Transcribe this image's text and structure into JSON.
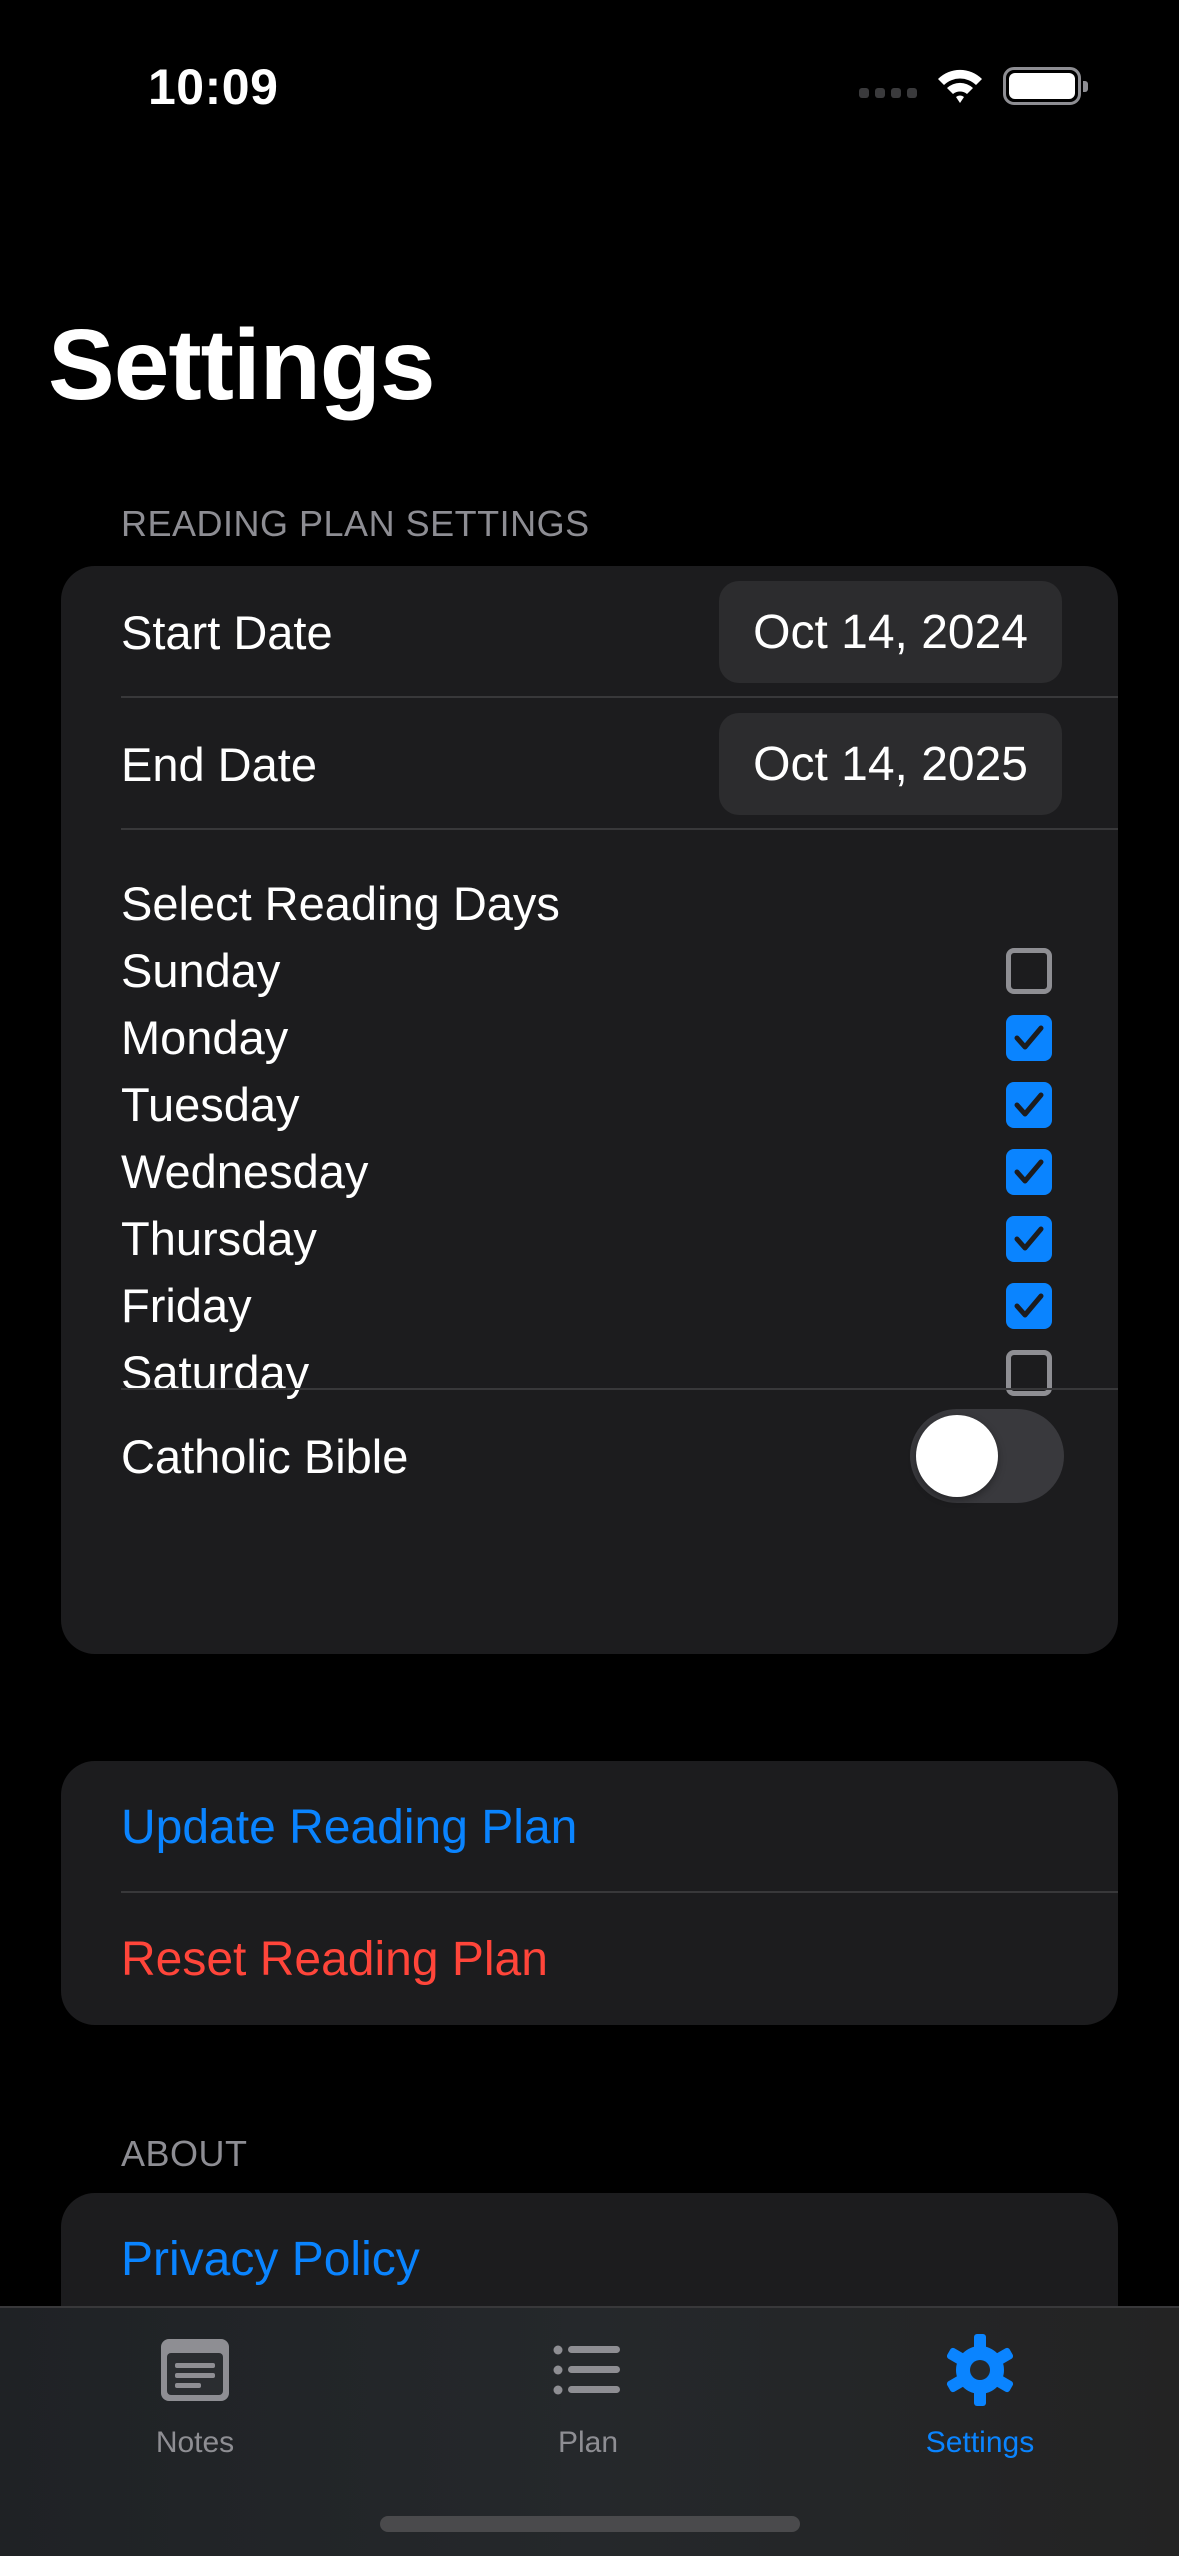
{
  "status_bar": {
    "time": "10:09",
    "icons": [
      "cellular-signal-icon",
      "wifi-icon",
      "battery-icon"
    ]
  },
  "header": {
    "title": "Settings"
  },
  "reading_plan": {
    "section_header": "READING PLAN SETTINGS",
    "start_date": {
      "label": "Start Date",
      "value": "Oct 14, 2024"
    },
    "end_date": {
      "label": "End Date",
      "value": "Oct 14, 2025"
    },
    "days_title": "Select Reading Days",
    "days": [
      {
        "label": "Sunday",
        "checked": false
      },
      {
        "label": "Monday",
        "checked": true
      },
      {
        "label": "Tuesday",
        "checked": true
      },
      {
        "label": "Wednesday",
        "checked": true
      },
      {
        "label": "Thursday",
        "checked": true
      },
      {
        "label": "Friday",
        "checked": true
      },
      {
        "label": "Saturday",
        "checked": false
      }
    ],
    "catholic_bible": {
      "label": "Catholic Bible",
      "on": false
    }
  },
  "actions": {
    "update_label": "Update Reading Plan",
    "reset_label": "Reset Reading Plan"
  },
  "about": {
    "section_header": "ABOUT",
    "privacy_label": "Privacy Policy"
  },
  "tab_bar": {
    "tabs": [
      {
        "label": "Notes",
        "icon": "notes-icon",
        "active": false
      },
      {
        "label": "Plan",
        "icon": "list-icon",
        "active": false
      },
      {
        "label": "Settings",
        "icon": "gear-icon",
        "active": true
      }
    ]
  },
  "colors": {
    "accent": "#0a84ff",
    "destructive": "#ff453a",
    "background": "#000000",
    "group_background": "#1c1c1e"
  }
}
